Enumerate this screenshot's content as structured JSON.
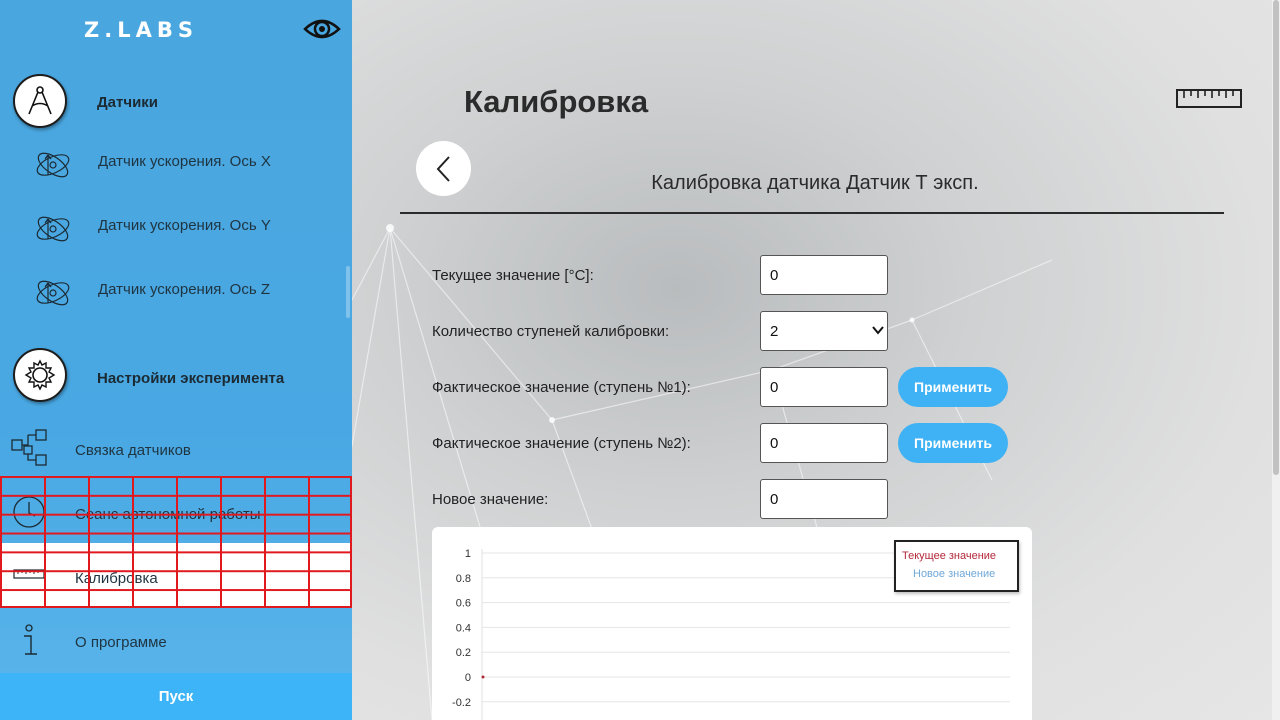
{
  "brand": {
    "logo": "Z.LABS"
  },
  "sidebar": {
    "sensors_section": {
      "label": "Датчики"
    },
    "sensors": [
      {
        "label": "Датчик ускорения. Ось X"
      },
      {
        "label": "Датчик ускорения. Ось Y"
      },
      {
        "label": "Датчик ускорения. Ось Z"
      }
    ],
    "settings_section": {
      "label": "Настройки эксперимента"
    },
    "settings_items": [
      {
        "label": "Связка датчиков",
        "icon": "flowchart-icon"
      },
      {
        "label": "Сеанс автономной работы",
        "icon": "clock-icon"
      },
      {
        "label": "Калибровка",
        "icon": "ruler-icon"
      },
      {
        "label": "О программе",
        "icon": "info-icon"
      }
    ],
    "run_button": "Пуск"
  },
  "main": {
    "page_title": "Калибровка",
    "subtitle": "Калибровка датчика Датчик Т эксп.",
    "form": {
      "current_value": {
        "label": "Текущее значение [°C]:",
        "value": "0"
      },
      "steps_count": {
        "label": "Количество ступеней калибровки:",
        "value": "2",
        "options": [
          "2"
        ]
      },
      "actual_step1": {
        "label": "Фактическое значение (ступень №1):",
        "value": "0",
        "button": "Применить"
      },
      "actual_step2": {
        "label": "Фактическое значение (ступень №2):",
        "value": "0",
        "button": "Применить"
      },
      "new_value": {
        "label": "Новое значение:",
        "value": "0"
      }
    }
  },
  "chart_data": {
    "type": "line",
    "y_ticks": [
      "1",
      "0.8",
      "0.6",
      "0.4",
      "0.2",
      "0",
      "-0.2"
    ],
    "ylim": [
      -0.2,
      1
    ],
    "series": [
      {
        "name": "Текущее значение",
        "color": "#b4283a",
        "values": [
          0
        ]
      },
      {
        "name": "Новое значение",
        "color": "#6fa8d8",
        "values": []
      }
    ],
    "grid": true,
    "legend_position": "top-right"
  },
  "colors": {
    "sidebar": "#49a8e3",
    "accent": "#3fb2f5"
  }
}
